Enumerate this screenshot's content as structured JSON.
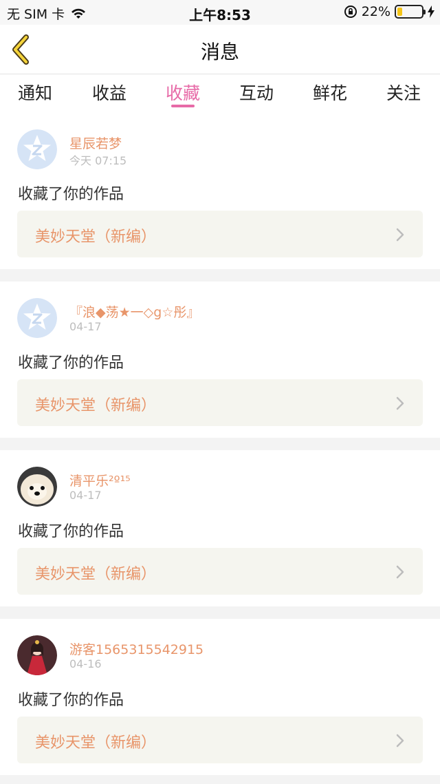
{
  "status": {
    "carrier": "无 SIM 卡",
    "time": "上午8:53",
    "battery": "22%",
    "battery_level": 0.22
  },
  "nav": {
    "title": "消息",
    "back_icon": "chevron-left-icon"
  },
  "tabs": [
    {
      "label": "通知"
    },
    {
      "label": "收益"
    },
    {
      "label": "收藏",
      "active": true
    },
    {
      "label": "互动"
    },
    {
      "label": "鲜花"
    },
    {
      "label": "关注"
    }
  ],
  "items": [
    {
      "user": "星辰若梦",
      "time": "今天 07:15",
      "message": "收藏了你的作品",
      "work": "美妙天堂（新编）",
      "avatar": "qq-default-avatar"
    },
    {
      "user": "『浪◆荡★一◇g☆彤』",
      "time": "04-17",
      "message": "收藏了你的作品",
      "work": "美妙天堂（新编）",
      "avatar": "qq-default-avatar"
    },
    {
      "user": "清平乐²º¹⁵",
      "time": "04-17",
      "message": "收藏了你的作品",
      "work": "美妙天堂（新编）",
      "avatar": "puppy-avatar"
    },
    {
      "user": "游客1565315542915",
      "time": "04-16",
      "message": "收藏了你的作品",
      "work": "美妙天堂（新编）",
      "avatar": "red-dress-girl-avatar"
    }
  ],
  "colors": {
    "accent_pink": "#e76aa7",
    "username_orange": "#e8956a",
    "work_box_bg": "#f5f5ef"
  }
}
